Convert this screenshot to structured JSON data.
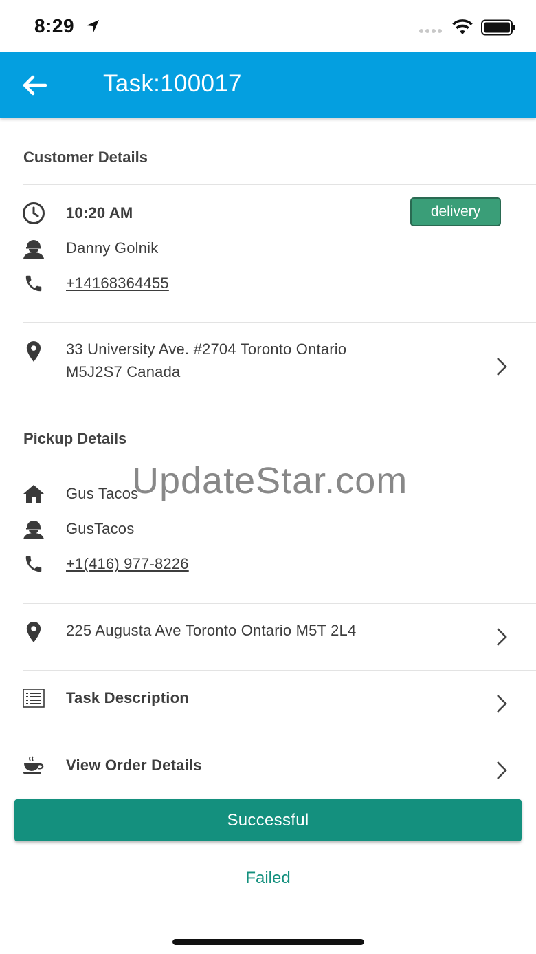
{
  "status_bar": {
    "time": "8:29"
  },
  "app_bar": {
    "title": "Task:100017"
  },
  "customer": {
    "header": "Customer Details",
    "time": "10:20 AM",
    "badge": "delivery",
    "name": "Danny Golnik",
    "phone": "+14168364455",
    "address_line1": "33 University Ave. #2704 Toronto Ontario",
    "address_line2": "M5J2S7 Canada"
  },
  "pickup": {
    "header": "Pickup Details",
    "place": "Gus Tacos",
    "contact": "GusTacos",
    "phone": "+1(416) 977-8226",
    "address": "225 Augusta Ave Toronto Ontario M5T 2L4"
  },
  "menu": {
    "task_description": "Task Description",
    "view_order_details": "View Order Details"
  },
  "actions": {
    "successful": "Successful",
    "failed": "Failed"
  },
  "watermark": "UpdateStar.com",
  "colors": {
    "app_bar": "#049fe0",
    "badge": "#3a9e78",
    "primary_button": "#14907e"
  }
}
